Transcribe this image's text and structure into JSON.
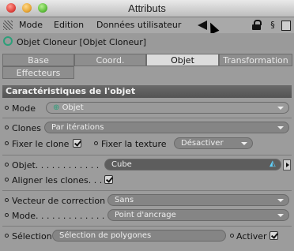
{
  "window": {
    "title": "Attributs"
  },
  "menubar": {
    "items": [
      "Mode",
      "Edition",
      "Données utilisateur"
    ]
  },
  "object": {
    "title": "Objet Cloneur [Objet Cloneur]"
  },
  "tabs": [
    {
      "label": "Base",
      "active": false
    },
    {
      "label": "Coord.",
      "active": false
    },
    {
      "label": "Objet",
      "active": true
    },
    {
      "label": "Transformation",
      "active": false
    },
    {
      "label": "Effecteurs",
      "active": false
    }
  ],
  "section": {
    "title": "Caractéristiques de l'objet"
  },
  "props": {
    "mode_label": "Mode",
    "mode_value": "Objet",
    "clones_label": "Clones",
    "clones_value": "Par itérations",
    "fix_clone_label": "Fixer le clone",
    "fix_clone_checked": true,
    "fix_texture_label": "Fixer la texture",
    "fix_texture_value": "Désactiver",
    "objet_label": "Objet. . . . . . . . . . . .",
    "objet_value": "Cube",
    "align_label": "Aligner les clones. . .",
    "align_checked": true,
    "vector_label": "Vecteur de correction",
    "vector_value": "Sans",
    "mode2_label": "Mode. . . . . . . . . . . . .",
    "mode2_value": "Point d'ancrage",
    "selection_label": "Sélection",
    "selection_value": "Sélection de polygones",
    "active_label": "Activer",
    "active_checked": true
  },
  "colors": {
    "accent": "#2d9f7a"
  }
}
